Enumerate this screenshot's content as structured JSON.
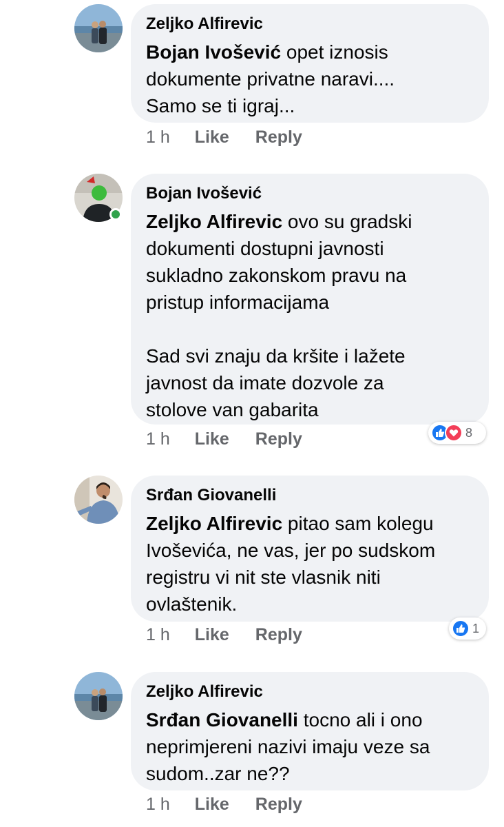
{
  "comments": [
    {
      "author": "Zeljko Alfirevic",
      "mention": "Bojan Ivošević",
      "text": " opet iznosis\ndokumente privatne naravi....\nSamo se ti igraj...",
      "time": "1 h",
      "like_label": "Like",
      "reply_label": "Reply"
    },
    {
      "author": "Bojan Ivošević",
      "mention": "Zeljko Alfirevic",
      "text": " ovo su gradski\ndokumenti dostupni javnosti\nsukladno zakonskom pravu na\npristup informacijama\n\nSad svi znaju da kršite i lažete\njavnost da imate dozvole za\nstolove van gabarita",
      "time": "1 h",
      "like_label": "Like",
      "reply_label": "Reply",
      "reaction_count": "8"
    },
    {
      "author": "Srđan Giovanelli",
      "mention": "Zeljko Alfirevic",
      "text": " pitao sam kolegu\nIvoševića, ne vas, jer po sudskom\nregistru vi nit ste vlasnik niti\novlaštenik.",
      "time": "1 h",
      "like_label": "Like",
      "reply_label": "Reply",
      "reaction_count": "1"
    },
    {
      "author": "Zeljko Alfirevic",
      "mention": "Srđan Giovanelli",
      "text": " tocno ali i ono\nneprimjereni nazivi imaju veze sa\nsudom..zar ne??",
      "time": "1 h",
      "like_label": "Like",
      "reply_label": "Reply"
    }
  ],
  "colors": {
    "bubble": "#f0f2f5",
    "secondary_text": "#65676b",
    "like_blue": "#1877f2",
    "love_red": "#f33e58",
    "online_green": "#31a24c"
  },
  "icons": {
    "like_reaction": "thumbs-up-icon",
    "love_reaction": "heart-icon"
  }
}
